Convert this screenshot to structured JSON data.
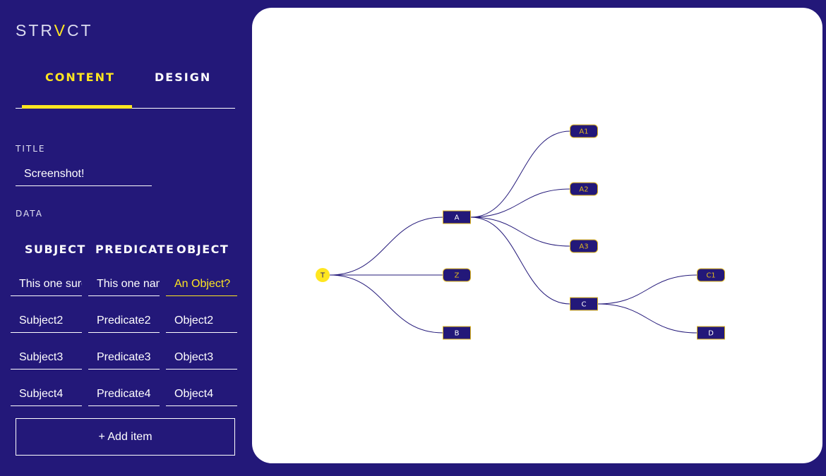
{
  "app": {
    "logo_prefix": "STR",
    "logo_accent": "V",
    "logo_suffix": "CT"
  },
  "tabs": [
    {
      "label": "CONTENT",
      "active": true
    },
    {
      "label": "DESIGN",
      "active": false
    }
  ],
  "form": {
    "title_label": "TITLE",
    "title_value": "Screenshot!",
    "data_label": "DATA",
    "columns": [
      "SUBJECT",
      "PREDICATE",
      "OBJECT"
    ],
    "rows": [
      {
        "subject": "This one sure",
        "predicate": "This one name",
        "object": "An Object?"
      },
      {
        "subject": "Subject2",
        "predicate": "Predicate2",
        "object": "Object2"
      },
      {
        "subject": "Subject3",
        "predicate": "Predicate3",
        "object": "Object3"
      },
      {
        "subject": "Subject4",
        "predicate": "Predicate4",
        "object": "Object4"
      }
    ],
    "add_button": "+ Add item"
  },
  "graph": {
    "colors": {
      "node_fill": "#231879",
      "node_border": "#e0b81e",
      "root_fill": "#ffe620",
      "edge": "#231879",
      "label": "#ffffff"
    },
    "nodes": [
      {
        "id": "T",
        "label": "T",
        "shape": "circle"
      },
      {
        "id": "A",
        "label": "A",
        "shape": "box"
      },
      {
        "id": "Z",
        "label": "Z",
        "shape": "rounded"
      },
      {
        "id": "B",
        "label": "B",
        "shape": "box"
      },
      {
        "id": "A1",
        "label": "A1",
        "shape": "rounded"
      },
      {
        "id": "A2",
        "label": "A2",
        "shape": "rounded"
      },
      {
        "id": "A3",
        "label": "A3",
        "shape": "rounded"
      },
      {
        "id": "C",
        "label": "C",
        "shape": "box"
      },
      {
        "id": "C1",
        "label": "C1",
        "shape": "rounded"
      },
      {
        "id": "D",
        "label": "D",
        "shape": "box"
      }
    ],
    "edges": [
      [
        "T",
        "A"
      ],
      [
        "T",
        "Z"
      ],
      [
        "T",
        "B"
      ],
      [
        "A",
        "A1"
      ],
      [
        "A",
        "A2"
      ],
      [
        "A",
        "A3"
      ],
      [
        "A",
        "C"
      ],
      [
        "C",
        "C1"
      ],
      [
        "C",
        "D"
      ]
    ]
  }
}
